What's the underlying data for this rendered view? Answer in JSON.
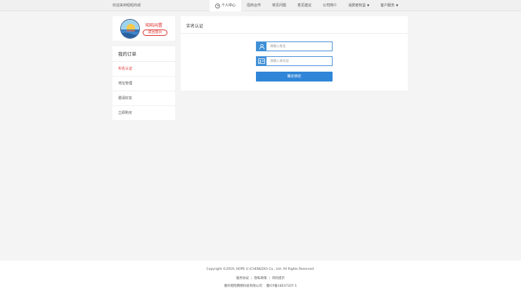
{
  "header": {
    "welcome": "欢迎来到昭昭商城",
    "nav": [
      {
        "label": "个人中心",
        "icon": "user-icon",
        "active": true
      },
      {
        "label": "招商合作"
      },
      {
        "label": "常见问题"
      },
      {
        "label": "意见建议"
      },
      {
        "label": "公司简介"
      },
      {
        "label": "消费者权益",
        "dropdown": true
      },
      {
        "label": "客户服务",
        "dropdown": true
      }
    ]
  },
  "profile": {
    "name": "昭昭闲置",
    "home_button": "返回首页"
  },
  "sidebar": {
    "title": "我的订单",
    "items": [
      {
        "label": "实名认证",
        "active": true
      },
      {
        "label": "地址管理"
      },
      {
        "label": "邀请好友"
      },
      {
        "label": "立即购买"
      }
    ]
  },
  "main": {
    "title": "实名认证",
    "name_placeholder": "请输入姓名",
    "id_placeholder": "请输入身份证",
    "submit": "确定绑定"
  },
  "footer": {
    "copyright": "Copyright ©2019, HOPE U (CHENGDU) Co., Ltd. All Rights Reserved.",
    "links": [
      "服务协议",
      "隐私政策",
      "风险提示"
    ],
    "company": "重庆昭昭网络科技有限公司",
    "icp": "蜀ICP备18037207-1"
  },
  "colors": {
    "accent": "#2f85d8",
    "active_red": "#e03030",
    "background": "#f4f4f4"
  }
}
